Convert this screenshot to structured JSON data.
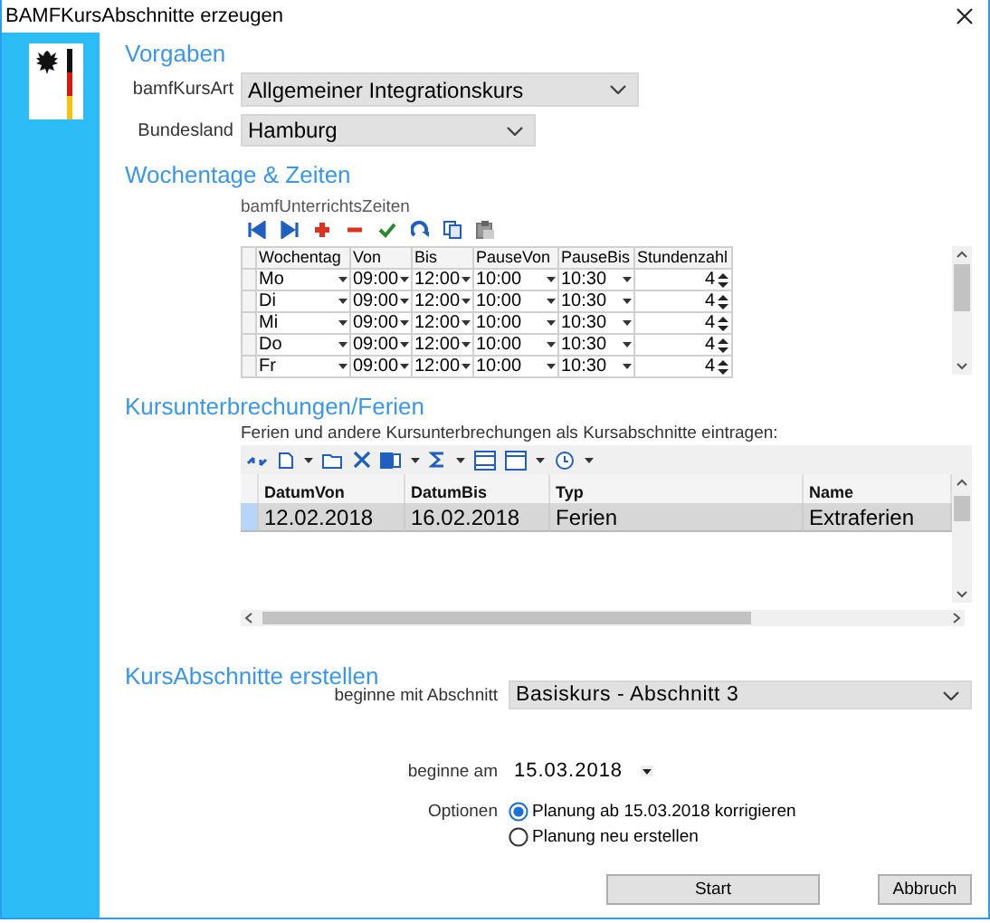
{
  "window": {
    "title": "BAMFKursAbschnitte erzeugen"
  },
  "vorgaben": {
    "heading": "Vorgaben",
    "fields": [
      {
        "label": "bamfKursArt",
        "value": "Allgemeiner Integrationskurs"
      },
      {
        "label": "Bundesland",
        "value": "Hamburg"
      }
    ]
  },
  "wochentage": {
    "heading": "Wochentage & Zeiten",
    "grid_label": "bamfUnterrichtsZeiten",
    "columns": [
      "Wochentag",
      "Von",
      "Bis",
      "PauseVon",
      "PauseBis",
      "Stundenzahl"
    ],
    "rows": [
      [
        "Mo",
        "09:00",
        "12:00",
        "10:00",
        "10:30",
        "4"
      ],
      [
        "Di",
        "09:00",
        "12:00",
        "10:00",
        "10:30",
        "4"
      ],
      [
        "Mi",
        "09:00",
        "12:00",
        "10:00",
        "10:30",
        "4"
      ],
      [
        "Do",
        "09:00",
        "12:00",
        "10:00",
        "10:30",
        "4"
      ],
      [
        "Fr",
        "09:00",
        "12:00",
        "10:00",
        "10:30",
        "4"
      ]
    ]
  },
  "kursunterbrechungen": {
    "heading": "Kursunterbrechungen/Ferien",
    "intro": "Ferien und andere Kursunterbrechungen als Kursabschnitte eintragen:",
    "columns": [
      "DatumVon",
      "DatumBis",
      "Typ",
      "Name"
    ],
    "rows": [
      {
        "cells": [
          "12.02.2018",
          "16.02.2018",
          "Ferien",
          "Extraferien"
        ],
        "selected": true
      }
    ]
  },
  "kursabschnitte": {
    "heading": "KursAbschnitte erstellen",
    "abschnitt": {
      "label": "beginne mit Abschnitt",
      "value": "Basiskurs - Abschnitt 3"
    },
    "beginn": {
      "label": "beginne am",
      "value": "15.03.2018"
    },
    "optionen": {
      "label": "Optionen",
      "options": [
        {
          "label": "Planung ab 15.03.2018 korrigieren",
          "selected": true
        },
        {
          "label": "Planung neu erstellen",
          "selected": false
        }
      ]
    }
  },
  "buttons": [
    "Start",
    "Abbruch"
  ]
}
